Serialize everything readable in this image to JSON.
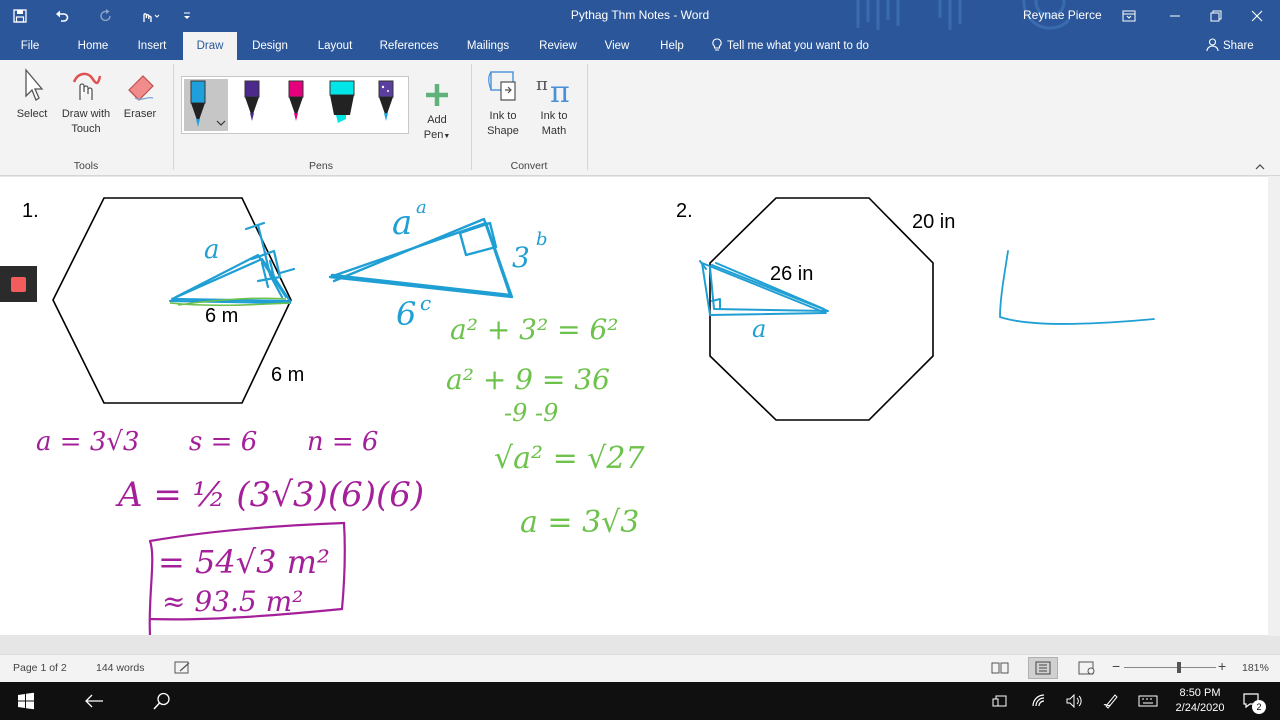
{
  "titlebar": {
    "doc_title": "Pythag Thm Notes  -  Word",
    "user": "Reynae Pierce",
    "qat": {
      "save_icon": "save-icon",
      "undo_icon": "undo-icon",
      "redo_icon": "redo-icon",
      "touch_icon": "touch-mode-icon",
      "customize_icon": "customize-icon"
    },
    "colors": {
      "brand": "#2b579a"
    }
  },
  "tabs": {
    "items": [
      {
        "label": "File"
      },
      {
        "label": "Home"
      },
      {
        "label": "Insert"
      },
      {
        "label": "Draw"
      },
      {
        "label": "Design"
      },
      {
        "label": "Layout"
      },
      {
        "label": "References"
      },
      {
        "label": "Mailings"
      },
      {
        "label": "Review"
      },
      {
        "label": "View"
      },
      {
        "label": "Help"
      }
    ],
    "active": "Draw",
    "tell_me": "Tell me what you want to do",
    "share": "Share"
  },
  "ribbon": {
    "tools": {
      "select": "Select",
      "draw_with_touch_1": "Draw with",
      "draw_with_touch_2": "Touch",
      "eraser": "Eraser",
      "label": "Tools"
    },
    "pens": {
      "label": "Pens",
      "add_pen_1": "Add",
      "add_pen_2": "Pen",
      "colors": [
        "#1fa0dc",
        "#4b2a8c",
        "#e6007e",
        "#00e5e5",
        "#1fa0dc"
      ]
    },
    "convert": {
      "ink_to_shape_1": "Ink to",
      "ink_to_shape_2": "Shape",
      "ink_to_math_1": "Ink to",
      "ink_to_math_2": "Math",
      "label": "Convert"
    }
  },
  "document": {
    "problem1": {
      "number": "1.",
      "apothem_label": "6 m",
      "side_label": "6 m",
      "ink_blue": {
        "a": "a",
        "a_sup": "a",
        "b": "3",
        "b_sup": "b",
        "c": "6",
        "c_sup": "c"
      },
      "ink_green": {
        "step1": "a² + 3² = 6²",
        "step2": "a² + 9 = 36",
        "step3": "-9   -9",
        "step4": "√a² = √27",
        "step5": "a = 3√3"
      },
      "ink_purple": {
        "givens": "a = 3√3      s = 6      n = 6",
        "formula": "A = ½ (3√3)(6)(6)",
        "result_exact": "= 54√3 m²",
        "result_approx": "≈ 93.5 m²"
      }
    },
    "problem2": {
      "number": "2.",
      "radius_label": "26 in",
      "side_label": "20 in",
      "ink_a": "a"
    },
    "ink_colors": {
      "blue": "#1f9fd3",
      "green": "#6cc24a",
      "purple": "#a4209a"
    }
  },
  "statusbar": {
    "page": "Page 1 of 2",
    "words": "144 words",
    "zoom": "181%"
  },
  "taskbar": {
    "time": "8:50 PM",
    "date": "2/24/2020",
    "notifications": "2"
  }
}
